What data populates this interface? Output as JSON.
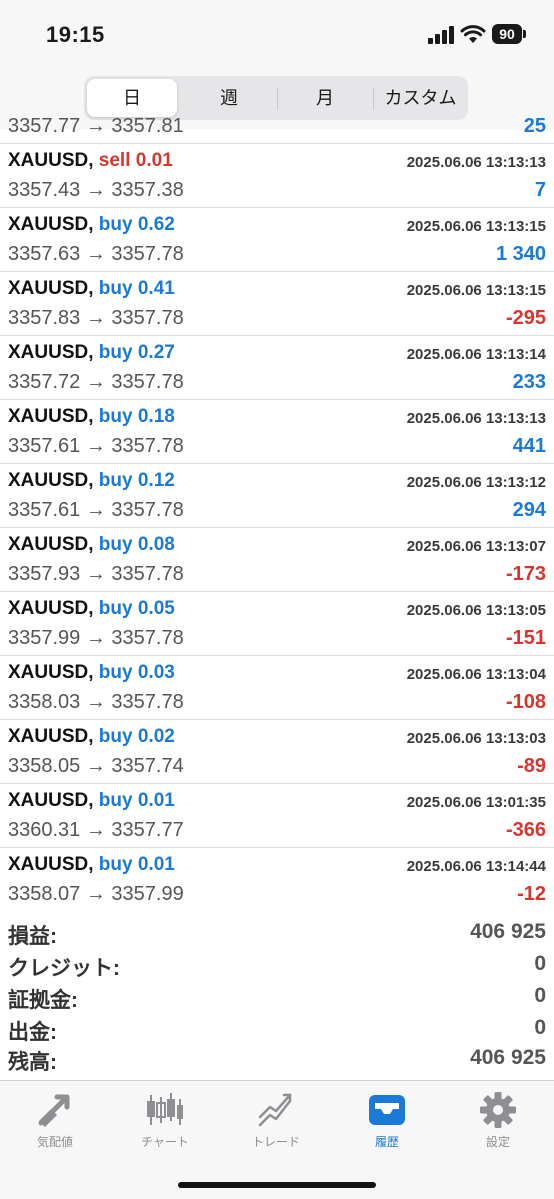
{
  "status": {
    "time": "19:15",
    "battery": "90"
  },
  "segments": [
    "日",
    "週",
    "月",
    "カスタム"
  ],
  "partial_row": {
    "prices": "3357.77 → 3357.81",
    "profit": "25"
  },
  "trades": [
    {
      "symbol": "XAUUSD,",
      "side": "sell",
      "volume": "0.01",
      "date": "2025.06.06 13:13:13",
      "open": "3357.43",
      "close": "3357.38",
      "profit": "7"
    },
    {
      "symbol": "XAUUSD,",
      "side": "buy",
      "volume": "0.62",
      "date": "2025.06.06 13:13:15",
      "open": "3357.63",
      "close": "3357.78",
      "profit": "1 340"
    },
    {
      "symbol": "XAUUSD,",
      "side": "buy",
      "volume": "0.41",
      "date": "2025.06.06 13:13:15",
      "open": "3357.83",
      "close": "3357.78",
      "profit": "-295"
    },
    {
      "symbol": "XAUUSD,",
      "side": "buy",
      "volume": "0.27",
      "date": "2025.06.06 13:13:14",
      "open": "3357.72",
      "close": "3357.78",
      "profit": "233"
    },
    {
      "symbol": "XAUUSD,",
      "side": "buy",
      "volume": "0.18",
      "date": "2025.06.06 13:13:13",
      "open": "3357.61",
      "close": "3357.78",
      "profit": "441"
    },
    {
      "symbol": "XAUUSD,",
      "side": "buy",
      "volume": "0.12",
      "date": "2025.06.06 13:13:12",
      "open": "3357.61",
      "close": "3357.78",
      "profit": "294"
    },
    {
      "symbol": "XAUUSD,",
      "side": "buy",
      "volume": "0.08",
      "date": "2025.06.06 13:13:07",
      "open": "3357.93",
      "close": "3357.78",
      "profit": "-173"
    },
    {
      "symbol": "XAUUSD,",
      "side": "buy",
      "volume": "0.05",
      "date": "2025.06.06 13:13:05",
      "open": "3357.99",
      "close": "3357.78",
      "profit": "-151"
    },
    {
      "symbol": "XAUUSD,",
      "side": "buy",
      "volume": "0.03",
      "date": "2025.06.06 13:13:04",
      "open": "3358.03",
      "close": "3357.78",
      "profit": "-108"
    },
    {
      "symbol": "XAUUSD,",
      "side": "buy",
      "volume": "0.02",
      "date": "2025.06.06 13:13:03",
      "open": "3358.05",
      "close": "3357.74",
      "profit": "-89"
    },
    {
      "symbol": "XAUUSD,",
      "side": "buy",
      "volume": "0.01",
      "date": "2025.06.06 13:01:35",
      "open": "3360.31",
      "close": "3357.77",
      "profit": "-366"
    },
    {
      "symbol": "XAUUSD,",
      "side": "buy",
      "volume": "0.01",
      "date": "2025.06.06 13:14:44",
      "open": "3358.07",
      "close": "3357.99",
      "profit": "-12"
    }
  ],
  "summary": [
    {
      "label": "損益:",
      "value": "406 925"
    },
    {
      "label": "クレジット:",
      "value": "0"
    },
    {
      "label": "証拠金:",
      "value": "0"
    },
    {
      "label": "出金:",
      "value": "0"
    },
    {
      "label": "残高:",
      "value": "406 925"
    }
  ],
  "tabs": [
    {
      "label": "気配値",
      "icon": "quotes-icon"
    },
    {
      "label": "チャート",
      "icon": "chart-icon"
    },
    {
      "label": "トレード",
      "icon": "trade-icon"
    },
    {
      "label": "履歴",
      "icon": "history-icon",
      "active": true
    },
    {
      "label": "設定",
      "icon": "settings-icon"
    }
  ],
  "colors": {
    "buy": "#1a7ad6",
    "sell": "#d7352e",
    "positive": "#1a7ad6",
    "negative": "#d7352e",
    "active_tab": "#1a7ad6",
    "inactive_tab": "#8e8e93"
  }
}
